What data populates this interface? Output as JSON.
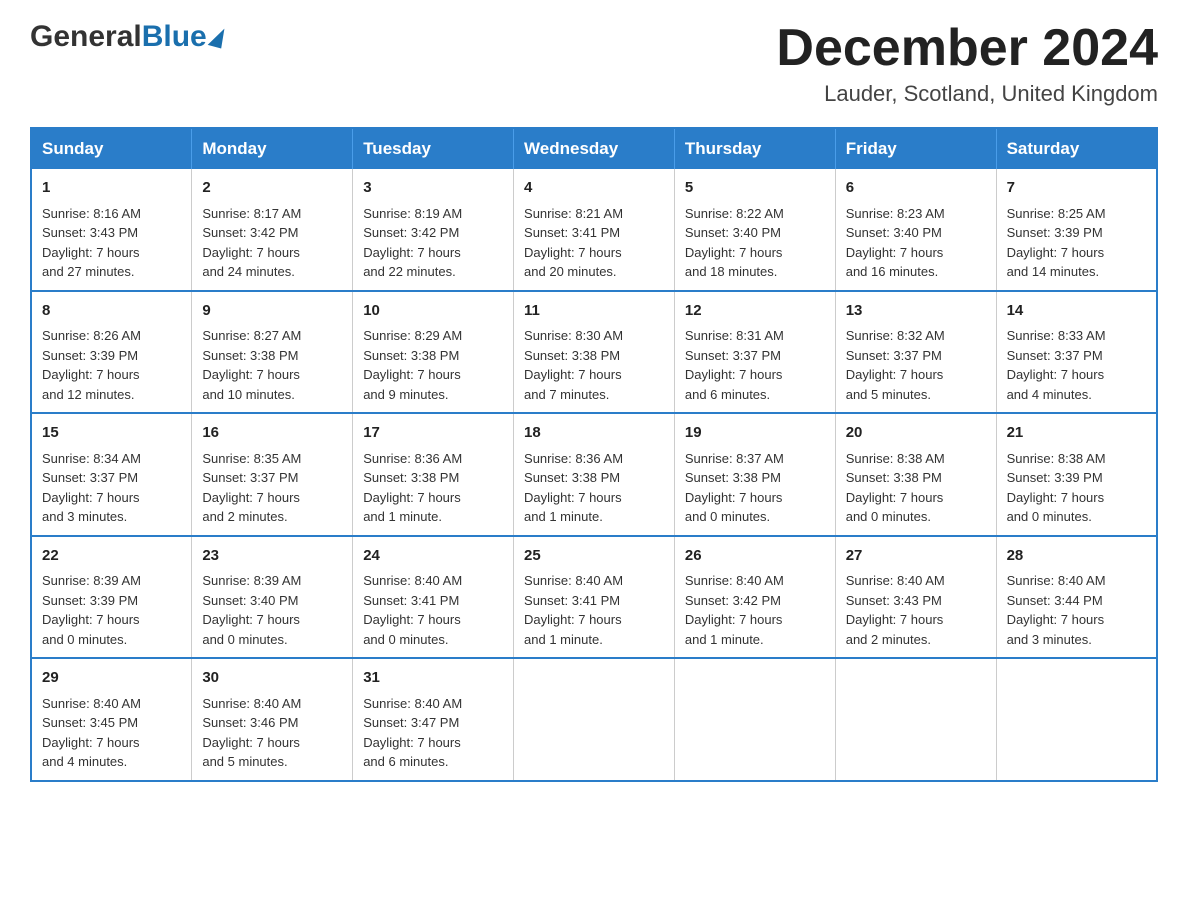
{
  "header": {
    "logo_general": "General",
    "logo_blue": "Blue",
    "month_title": "December 2024",
    "location": "Lauder, Scotland, United Kingdom"
  },
  "columns": [
    "Sunday",
    "Monday",
    "Tuesday",
    "Wednesday",
    "Thursday",
    "Friday",
    "Saturday"
  ],
  "weeks": [
    [
      {
        "day": "1",
        "sunrise": "Sunrise: 8:16 AM",
        "sunset": "Sunset: 3:43 PM",
        "daylight": "Daylight: 7 hours",
        "minutes": "and 27 minutes."
      },
      {
        "day": "2",
        "sunrise": "Sunrise: 8:17 AM",
        "sunset": "Sunset: 3:42 PM",
        "daylight": "Daylight: 7 hours",
        "minutes": "and 24 minutes."
      },
      {
        "day": "3",
        "sunrise": "Sunrise: 8:19 AM",
        "sunset": "Sunset: 3:42 PM",
        "daylight": "Daylight: 7 hours",
        "minutes": "and 22 minutes."
      },
      {
        "day": "4",
        "sunrise": "Sunrise: 8:21 AM",
        "sunset": "Sunset: 3:41 PM",
        "daylight": "Daylight: 7 hours",
        "minutes": "and 20 minutes."
      },
      {
        "day": "5",
        "sunrise": "Sunrise: 8:22 AM",
        "sunset": "Sunset: 3:40 PM",
        "daylight": "Daylight: 7 hours",
        "minutes": "and 18 minutes."
      },
      {
        "day": "6",
        "sunrise": "Sunrise: 8:23 AM",
        "sunset": "Sunset: 3:40 PM",
        "daylight": "Daylight: 7 hours",
        "minutes": "and 16 minutes."
      },
      {
        "day": "7",
        "sunrise": "Sunrise: 8:25 AM",
        "sunset": "Sunset: 3:39 PM",
        "daylight": "Daylight: 7 hours",
        "minutes": "and 14 minutes."
      }
    ],
    [
      {
        "day": "8",
        "sunrise": "Sunrise: 8:26 AM",
        "sunset": "Sunset: 3:39 PM",
        "daylight": "Daylight: 7 hours",
        "minutes": "and 12 minutes."
      },
      {
        "day": "9",
        "sunrise": "Sunrise: 8:27 AM",
        "sunset": "Sunset: 3:38 PM",
        "daylight": "Daylight: 7 hours",
        "minutes": "and 10 minutes."
      },
      {
        "day": "10",
        "sunrise": "Sunrise: 8:29 AM",
        "sunset": "Sunset: 3:38 PM",
        "daylight": "Daylight: 7 hours",
        "minutes": "and 9 minutes."
      },
      {
        "day": "11",
        "sunrise": "Sunrise: 8:30 AM",
        "sunset": "Sunset: 3:38 PM",
        "daylight": "Daylight: 7 hours",
        "minutes": "and 7 minutes."
      },
      {
        "day": "12",
        "sunrise": "Sunrise: 8:31 AM",
        "sunset": "Sunset: 3:37 PM",
        "daylight": "Daylight: 7 hours",
        "minutes": "and 6 minutes."
      },
      {
        "day": "13",
        "sunrise": "Sunrise: 8:32 AM",
        "sunset": "Sunset: 3:37 PM",
        "daylight": "Daylight: 7 hours",
        "minutes": "and 5 minutes."
      },
      {
        "day": "14",
        "sunrise": "Sunrise: 8:33 AM",
        "sunset": "Sunset: 3:37 PM",
        "daylight": "Daylight: 7 hours",
        "minutes": "and 4 minutes."
      }
    ],
    [
      {
        "day": "15",
        "sunrise": "Sunrise: 8:34 AM",
        "sunset": "Sunset: 3:37 PM",
        "daylight": "Daylight: 7 hours",
        "minutes": "and 3 minutes."
      },
      {
        "day": "16",
        "sunrise": "Sunrise: 8:35 AM",
        "sunset": "Sunset: 3:37 PM",
        "daylight": "Daylight: 7 hours",
        "minutes": "and 2 minutes."
      },
      {
        "day": "17",
        "sunrise": "Sunrise: 8:36 AM",
        "sunset": "Sunset: 3:38 PM",
        "daylight": "Daylight: 7 hours",
        "minutes": "and 1 minute."
      },
      {
        "day": "18",
        "sunrise": "Sunrise: 8:36 AM",
        "sunset": "Sunset: 3:38 PM",
        "daylight": "Daylight: 7 hours",
        "minutes": "and 1 minute."
      },
      {
        "day": "19",
        "sunrise": "Sunrise: 8:37 AM",
        "sunset": "Sunset: 3:38 PM",
        "daylight": "Daylight: 7 hours",
        "minutes": "and 0 minutes."
      },
      {
        "day": "20",
        "sunrise": "Sunrise: 8:38 AM",
        "sunset": "Sunset: 3:38 PM",
        "daylight": "Daylight: 7 hours",
        "minutes": "and 0 minutes."
      },
      {
        "day": "21",
        "sunrise": "Sunrise: 8:38 AM",
        "sunset": "Sunset: 3:39 PM",
        "daylight": "Daylight: 7 hours",
        "minutes": "and 0 minutes."
      }
    ],
    [
      {
        "day": "22",
        "sunrise": "Sunrise: 8:39 AM",
        "sunset": "Sunset: 3:39 PM",
        "daylight": "Daylight: 7 hours",
        "minutes": "and 0 minutes."
      },
      {
        "day": "23",
        "sunrise": "Sunrise: 8:39 AM",
        "sunset": "Sunset: 3:40 PM",
        "daylight": "Daylight: 7 hours",
        "minutes": "and 0 minutes."
      },
      {
        "day": "24",
        "sunrise": "Sunrise: 8:40 AM",
        "sunset": "Sunset: 3:41 PM",
        "daylight": "Daylight: 7 hours",
        "minutes": "and 0 minutes."
      },
      {
        "day": "25",
        "sunrise": "Sunrise: 8:40 AM",
        "sunset": "Sunset: 3:41 PM",
        "daylight": "Daylight: 7 hours",
        "minutes": "and 1 minute."
      },
      {
        "day": "26",
        "sunrise": "Sunrise: 8:40 AM",
        "sunset": "Sunset: 3:42 PM",
        "daylight": "Daylight: 7 hours",
        "minutes": "and 1 minute."
      },
      {
        "day": "27",
        "sunrise": "Sunrise: 8:40 AM",
        "sunset": "Sunset: 3:43 PM",
        "daylight": "Daylight: 7 hours",
        "minutes": "and 2 minutes."
      },
      {
        "day": "28",
        "sunrise": "Sunrise: 8:40 AM",
        "sunset": "Sunset: 3:44 PM",
        "daylight": "Daylight: 7 hours",
        "minutes": "and 3 minutes."
      }
    ],
    [
      {
        "day": "29",
        "sunrise": "Sunrise: 8:40 AM",
        "sunset": "Sunset: 3:45 PM",
        "daylight": "Daylight: 7 hours",
        "minutes": "and 4 minutes."
      },
      {
        "day": "30",
        "sunrise": "Sunrise: 8:40 AM",
        "sunset": "Sunset: 3:46 PM",
        "daylight": "Daylight: 7 hours",
        "minutes": "and 5 minutes."
      },
      {
        "day": "31",
        "sunrise": "Sunrise: 8:40 AM",
        "sunset": "Sunset: 3:47 PM",
        "daylight": "Daylight: 7 hours",
        "minutes": "and 6 minutes."
      },
      null,
      null,
      null,
      null
    ]
  ]
}
